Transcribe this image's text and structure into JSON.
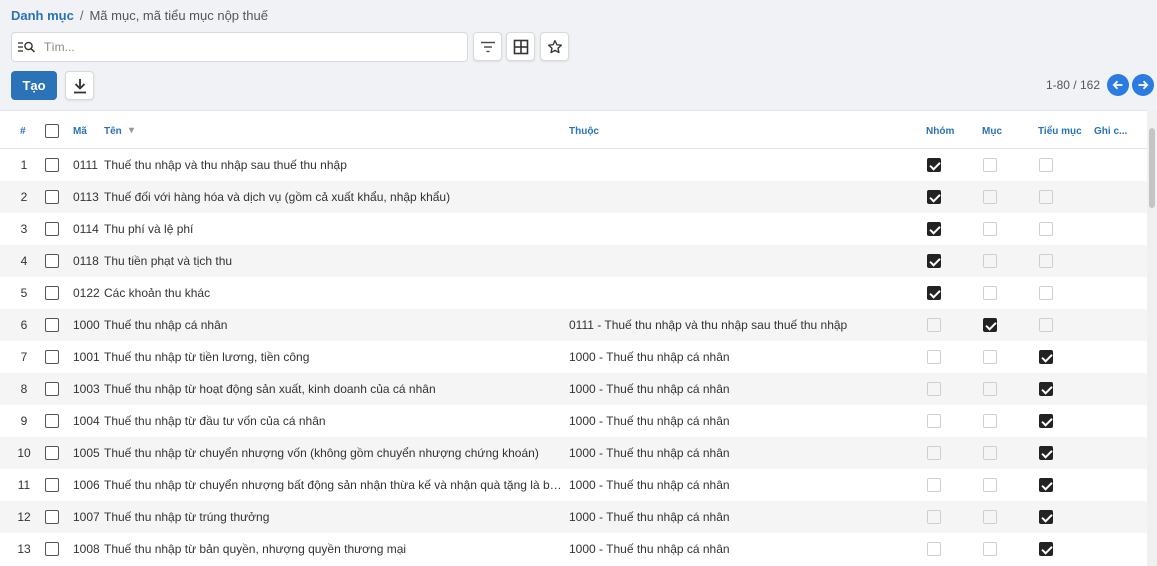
{
  "breadcrumb": {
    "root": "Danh mục",
    "separator": "/",
    "current": "Mã mục, mã tiểu mục nộp thuế"
  },
  "search": {
    "placeholder": "Tìm..."
  },
  "toolbar": {
    "create_label": "Tạo"
  },
  "pagination": {
    "text": "1-80 / 162"
  },
  "columns": {
    "index": "#",
    "code": "Mã",
    "name": "Tên",
    "parent": "Thuộc",
    "group": "Nhóm",
    "item": "Mục",
    "subitem": "Tiểu mục",
    "note": "Ghi c..."
  },
  "rows": [
    {
      "num": "1",
      "code": "0111",
      "name": "Thuế thu nhập và thu nhập sau thuế thu nhập",
      "parent": "",
      "group": true,
      "item": false,
      "subitem": false
    },
    {
      "num": "2",
      "code": "0113",
      "name": "Thuế đối với hàng hóa và dịch vụ (gồm cả xuất khẩu, nhập khẩu)",
      "parent": "",
      "group": true,
      "item": false,
      "subitem": false
    },
    {
      "num": "3",
      "code": "0114",
      "name": "Thu phí và lệ phí",
      "parent": "",
      "group": true,
      "item": false,
      "subitem": false
    },
    {
      "num": "4",
      "code": "0118",
      "name": "Thu tiền phạt và tịch thu",
      "parent": "",
      "group": true,
      "item": false,
      "subitem": false
    },
    {
      "num": "5",
      "code": "0122",
      "name": "Các khoản thu khác",
      "parent": "",
      "group": true,
      "item": false,
      "subitem": false
    },
    {
      "num": "6",
      "code": "1000",
      "name": "Thuế thu nhập cá nhân",
      "parent": "0111 - Thuế thu nhập và thu nhập sau thuế thu nhập",
      "group": false,
      "item": true,
      "subitem": false
    },
    {
      "num": "7",
      "code": "1001",
      "name": "Thuế thu nhập từ tiền lương, tiền công",
      "parent": "1000 - Thuế thu nhập cá nhân",
      "group": false,
      "item": false,
      "subitem": true
    },
    {
      "num": "8",
      "code": "1003",
      "name": "Thuế thu nhập từ hoạt động sản xuất, kinh doanh của cá nhân",
      "parent": "1000 - Thuế thu nhập cá nhân",
      "group": false,
      "item": false,
      "subitem": true
    },
    {
      "num": "9",
      "code": "1004",
      "name": "Thuế thu nhập từ đầu tư vốn của cá nhân",
      "parent": "1000 - Thuế thu nhập cá nhân",
      "group": false,
      "item": false,
      "subitem": true
    },
    {
      "num": "10",
      "code": "1005",
      "name": "Thuế thu nhập từ chuyển nhượng vốn (không gồm chuyển nhượng chứng khoán)",
      "parent": "1000 - Thuế thu nhập cá nhân",
      "group": false,
      "item": false,
      "subitem": true
    },
    {
      "num": "11",
      "code": "1006",
      "name": "Thuế thu nhập từ chuyển nhượng bất động sản nhận thừa kế và nhận quà tặng là bất động sản",
      "parent": "1000 - Thuế thu nhập cá nhân",
      "group": false,
      "item": false,
      "subitem": true
    },
    {
      "num": "12",
      "code": "1007",
      "name": "Thuế thu nhập từ trúng thưởng",
      "parent": "1000 - Thuế thu nhập cá nhân",
      "group": false,
      "item": false,
      "subitem": true
    },
    {
      "num": "13",
      "code": "1008",
      "name": "Thuế thu nhập từ bản quyền, nhượng quyền thương mại",
      "parent": "1000 - Thuế thu nhập cá nhân",
      "group": false,
      "item": false,
      "subitem": true
    }
  ]
}
